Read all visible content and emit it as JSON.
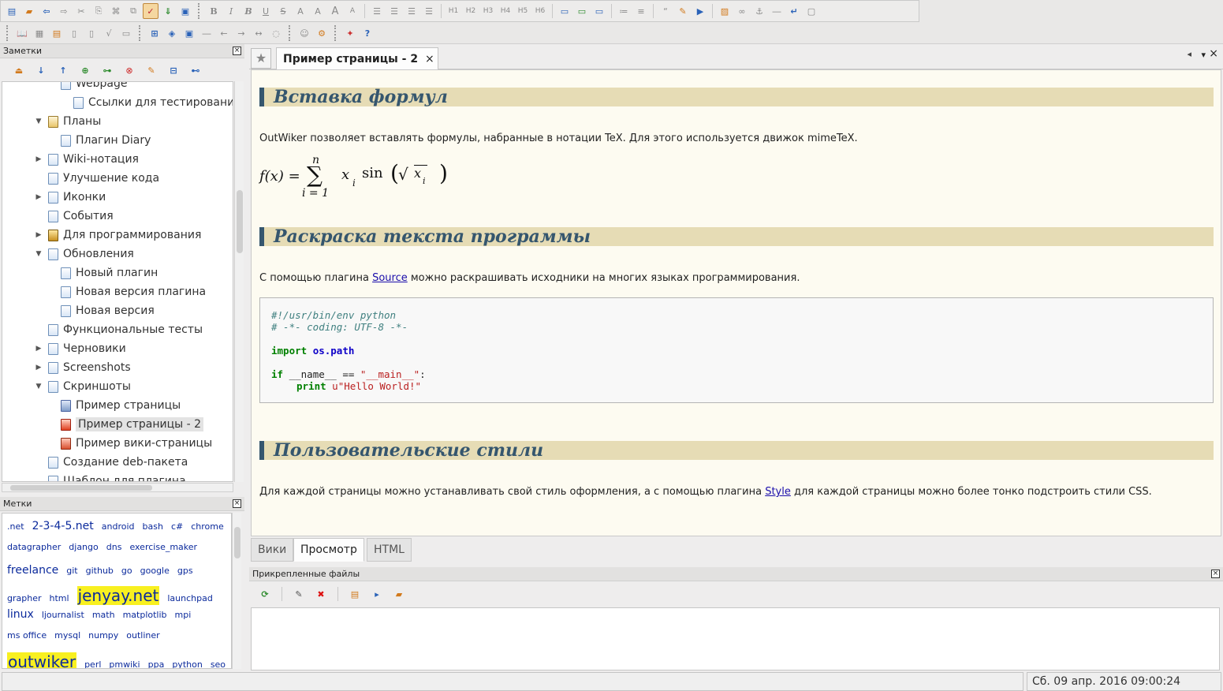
{
  "toolbar1": {
    "buttons": [
      "new-page",
      "open",
      "back",
      "forward",
      "cut",
      "copy",
      "paste",
      "spellcheck",
      "sort-down",
      "html-build",
      "bold",
      "italic",
      "bold-italic",
      "underline",
      "strike",
      "subscript",
      "superscript",
      "font-size-up",
      "font-size-down",
      "align-left",
      "align-center",
      "align-right",
      "justify",
      "h1",
      "h2",
      "h3",
      "h4",
      "h5",
      "h6",
      "align-top",
      "align-middle",
      "align-bottom",
      "list-unordered",
      "list-ordered",
      "quote",
      "marker",
      "code",
      "thumbnail",
      "link",
      "anchor",
      "horizontal-line",
      "line-break",
      "image"
    ],
    "heading_labels": [
      "H1",
      "H2",
      "H3",
      "H4",
      "H5",
      "H6"
    ],
    "text_format_glyphs": [
      "B",
      "I",
      "B",
      "U",
      "S",
      "A",
      "A",
      "A",
      "A"
    ]
  },
  "notes_panel": {
    "title": "Заметки",
    "tree": [
      {
        "label": "Webpage",
        "indent": 2,
        "arrow": "",
        "icon": "page"
      },
      {
        "label": "Ссылки для тестирования",
        "indent": 3,
        "arrow": "",
        "icon": "page"
      },
      {
        "label": "Планы",
        "indent": 1,
        "arrow": "▼",
        "icon": "notes"
      },
      {
        "label": "Плагин Diary",
        "indent": 2,
        "arrow": "",
        "icon": "page"
      },
      {
        "label": "Wiki-нотация",
        "indent": 1,
        "arrow": "▶",
        "icon": "page"
      },
      {
        "label": "Улучшение кода",
        "indent": 1,
        "arrow": "",
        "icon": "page"
      },
      {
        "label": "Иконки",
        "indent": 1,
        "arrow": "▶",
        "icon": "page"
      },
      {
        "label": "События",
        "indent": 1,
        "arrow": "",
        "icon": "page"
      },
      {
        "label": "Для программирования",
        "indent": 1,
        "arrow": "▶",
        "icon": "wand"
      },
      {
        "label": "Обновления",
        "indent": 1,
        "arrow": "▼",
        "icon": "page"
      },
      {
        "label": "Новый плагин",
        "indent": 2,
        "arrow": "",
        "icon": "page"
      },
      {
        "label": "Новая версия плагина",
        "indent": 2,
        "arrow": "",
        "icon": "page"
      },
      {
        "label": "Новая версия",
        "indent": 2,
        "arrow": "",
        "icon": "page"
      },
      {
        "label": "Функциональные тесты",
        "indent": 1,
        "arrow": "",
        "icon": "page"
      },
      {
        "label": "Черновики",
        "indent": 1,
        "arrow": "▶",
        "icon": "page"
      },
      {
        "label": "Screenshots",
        "indent": 1,
        "arrow": "▶",
        "icon": "page"
      },
      {
        "label": "Скриншоты",
        "indent": 1,
        "arrow": "▼",
        "icon": "page"
      },
      {
        "label": "Пример страницы",
        "indent": 2,
        "arrow": "",
        "icon": "person"
      },
      {
        "label": "Пример страницы - 2",
        "indent": 2,
        "arrow": "",
        "icon": "cone",
        "selected": true
      },
      {
        "label": "Пример вики-страницы",
        "indent": 2,
        "arrow": "",
        "icon": "hammer"
      },
      {
        "label": "Создание deb-пакета",
        "indent": 1,
        "arrow": "",
        "icon": "page"
      },
      {
        "label": "Шаблон для плагина",
        "indent": 1,
        "arrow": "",
        "icon": "page"
      }
    ]
  },
  "tags_panel": {
    "title": "Метки",
    "rows": [
      [
        {
          "t": ".net",
          "s": "s"
        },
        {
          "t": "2-3-4-5.net",
          "s": "m"
        },
        {
          "t": "android",
          "s": "s"
        },
        {
          "t": "bash",
          "s": "s"
        },
        {
          "t": "c#",
          "s": "s"
        },
        {
          "t": "chrome",
          "s": "s"
        }
      ],
      [
        {
          "t": "datagrapher",
          "s": "s"
        },
        {
          "t": "django",
          "s": "s"
        },
        {
          "t": "dns",
          "s": "s"
        },
        {
          "t": "exercise_maker",
          "s": "s"
        }
      ],
      [
        {
          "t": "freelance",
          "s": "m"
        },
        {
          "t": "git",
          "s": "s"
        },
        {
          "t": "github",
          "s": "s"
        },
        {
          "t": "go",
          "s": "s"
        },
        {
          "t": "google",
          "s": "s"
        },
        {
          "t": "gps",
          "s": "s"
        }
      ],
      [
        {
          "t": "grapher",
          "s": "s"
        },
        {
          "t": "html",
          "s": "s"
        },
        {
          "t": "jenyay.net",
          "s": "l"
        },
        {
          "t": "launchpad",
          "s": "s"
        }
      ],
      [
        {
          "t": "linux",
          "s": "m"
        },
        {
          "t": "ljournalist",
          "s": "s"
        },
        {
          "t": "math",
          "s": "s"
        },
        {
          "t": "matplotlib",
          "s": "s"
        },
        {
          "t": "mpi",
          "s": "s"
        }
      ],
      [
        {
          "t": "ms office",
          "s": "s"
        },
        {
          "t": "mysql",
          "s": "s"
        },
        {
          "t": "numpy",
          "s": "s"
        },
        {
          "t": "outliner",
          "s": "s"
        }
      ],
      [
        {
          "t": "outwiker",
          "s": "l"
        },
        {
          "t": "perl",
          "s": "s"
        },
        {
          "t": "pmwiki",
          "s": "s"
        },
        {
          "t": "ppa",
          "s": "s"
        },
        {
          "t": "python",
          "s": "s"
        },
        {
          "t": "seo",
          "s": "s"
        }
      ]
    ]
  },
  "page_tab": {
    "title": "Пример страницы - 2",
    "close": "×"
  },
  "page": {
    "h_formulas": "Вставка формул",
    "p_formulas": "OutWiker позволяет вставлять формулы, набранные в нотации TeX. Для этого используется движок mimeTeX.",
    "formula": {
      "lhs": "f(x) =",
      "top": "n",
      "sigma": "∑",
      "bottom": "i = 1",
      "x": "x",
      "sub_i": "i",
      "sin": "sin",
      "sqrt": "√"
    },
    "h_highlight": "Раскраска текста программы",
    "p_highlight_before": "С помощью плагина ",
    "p_highlight_link": "Source",
    "p_highlight_after": " можно раскрашивать исходники на многих языках программирования.",
    "code": {
      "line1": "#!/usr/bin/env python",
      "line2": "# -*- coding: UTF-8 -*-",
      "import_kw": "import",
      "import_mod": "os.path",
      "if_kw": "if",
      "if_mid": " __name__ == ",
      "if_str": "\"__main__\"",
      "if_end": ":",
      "print_kw": "print",
      "print_str": "u\"Hello World!\""
    },
    "h_styles": "Пользовательские стили",
    "p_styles_before": "Для каждой страницы можно устанавливать свой стиль оформления, а с помощью плагина ",
    "p_styles_link": "Style",
    "p_styles_after": " для каждой страницы можно более тонко подстроить стили CSS."
  },
  "bottom_tabs": [
    "Вики",
    "Просмотр",
    "HTML"
  ],
  "attachments": {
    "title": "Прикрепленные файлы"
  },
  "status": {
    "datetime": "Сб. 09 апр. 2016 09:00:24"
  },
  "colors": {
    "heading_bg": "#e6dcb5",
    "heading_text": "#35566e",
    "page_bg": "#fdfbf1",
    "link": "#1a0dab",
    "tag": "#0b2a9c",
    "tag_highlight": "#f8f020"
  }
}
